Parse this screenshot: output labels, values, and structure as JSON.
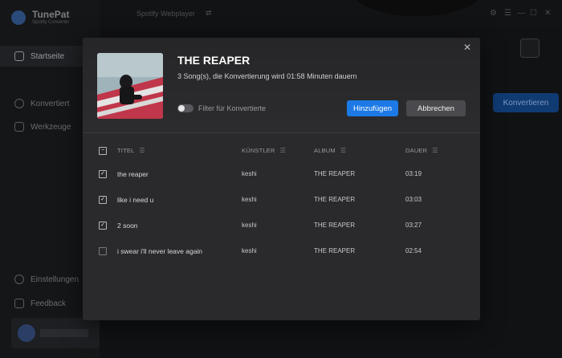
{
  "app": {
    "name": "TunePat",
    "subtitle": "Spotify Converter",
    "topbar_title": "Spotify Webplayer",
    "topbar_switch_icon": "⇄",
    "window_controls": [
      "⚙",
      "☰",
      "—",
      "☐",
      "✕"
    ]
  },
  "sidebar": {
    "items": [
      {
        "label": "Startseite",
        "icon": "home-icon"
      },
      {
        "label": "Konvertiert",
        "icon": "clock-icon"
      },
      {
        "label": "Werkzeuge",
        "icon": "tools-icon"
      },
      {
        "label": "Einstellungen",
        "icon": "settings-icon"
      },
      {
        "label": "Feedback",
        "icon": "mail-icon"
      }
    ]
  },
  "background": {
    "convert_label": "Konvertieren"
  },
  "dialog": {
    "close_icon": "✕",
    "album_title": "THE REAPER",
    "album_info": "3 Song(s), die Konvertierung wird 01:58 Minuten dauern",
    "filter_label": "Filter für Konvertierte",
    "add_label": "Hinzufügen",
    "cancel_label": "Abbrechen",
    "columns": {
      "title": "TITEL",
      "artist": "KÜNSTLER",
      "album": "ALBUM",
      "duration": "DAUER"
    },
    "sort_icon": "☰",
    "header_checkbox": "−",
    "rows": [
      {
        "checked": "✓",
        "title": "the reaper",
        "artist": "keshi",
        "album": "THE REAPER",
        "duration": "03:19"
      },
      {
        "checked": "✓",
        "title": "like i need u",
        "artist": "keshi",
        "album": "THE REAPER",
        "duration": "03:03"
      },
      {
        "checked": "✓",
        "title": "2 soon",
        "artist": "keshi",
        "album": "THE REAPER",
        "duration": "03:27"
      },
      {
        "checked": "",
        "title": "i swear i'll never leave again",
        "artist": "keshi",
        "album": "THE REAPER",
        "duration": "02:54"
      }
    ]
  },
  "colors": {
    "accent": "#1c79e6",
    "dialog_bg": "#2a2a2c",
    "app_bg": "#111214"
  }
}
